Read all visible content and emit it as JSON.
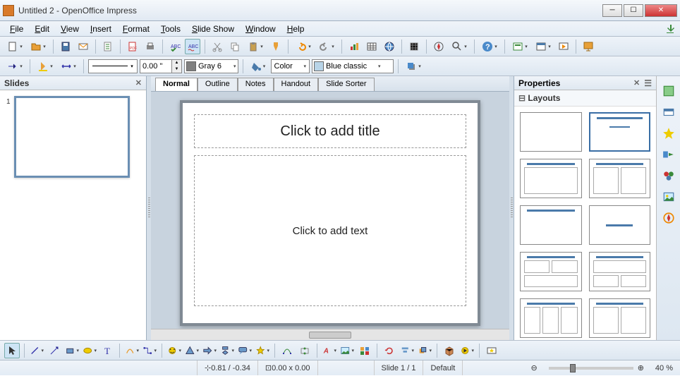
{
  "window": {
    "title": "Untitled 2 - OpenOffice Impress"
  },
  "menu": {
    "file": "File",
    "edit": "Edit",
    "view": "View",
    "insert": "Insert",
    "format": "Format",
    "tools": "Tools",
    "slideshow": "Slide Show",
    "window": "Window",
    "help": "Help"
  },
  "toolbar2": {
    "line_width": "0.00 \"",
    "line_color_label": "Gray 6",
    "line_color_hex": "#808080",
    "fill_mode": "Color",
    "fill_color_label": "Blue classic",
    "fill_color_hex": "#b8d4e8"
  },
  "slides_panel": {
    "title": "Slides",
    "slide1_num": "1"
  },
  "view_tabs": {
    "normal": "Normal",
    "outline": "Outline",
    "notes": "Notes",
    "handout": "Handout",
    "sorter": "Slide Sorter"
  },
  "slide": {
    "title_placeholder": "Click to add title",
    "body_placeholder": "Click to add text"
  },
  "properties": {
    "title": "Properties",
    "layouts": "Layouts"
  },
  "status": {
    "coords": "0.81 / -0.34",
    "size": "0.00 x 0.00",
    "slide": "Slide 1 / 1",
    "style": "Default",
    "zoom": "40 %"
  }
}
